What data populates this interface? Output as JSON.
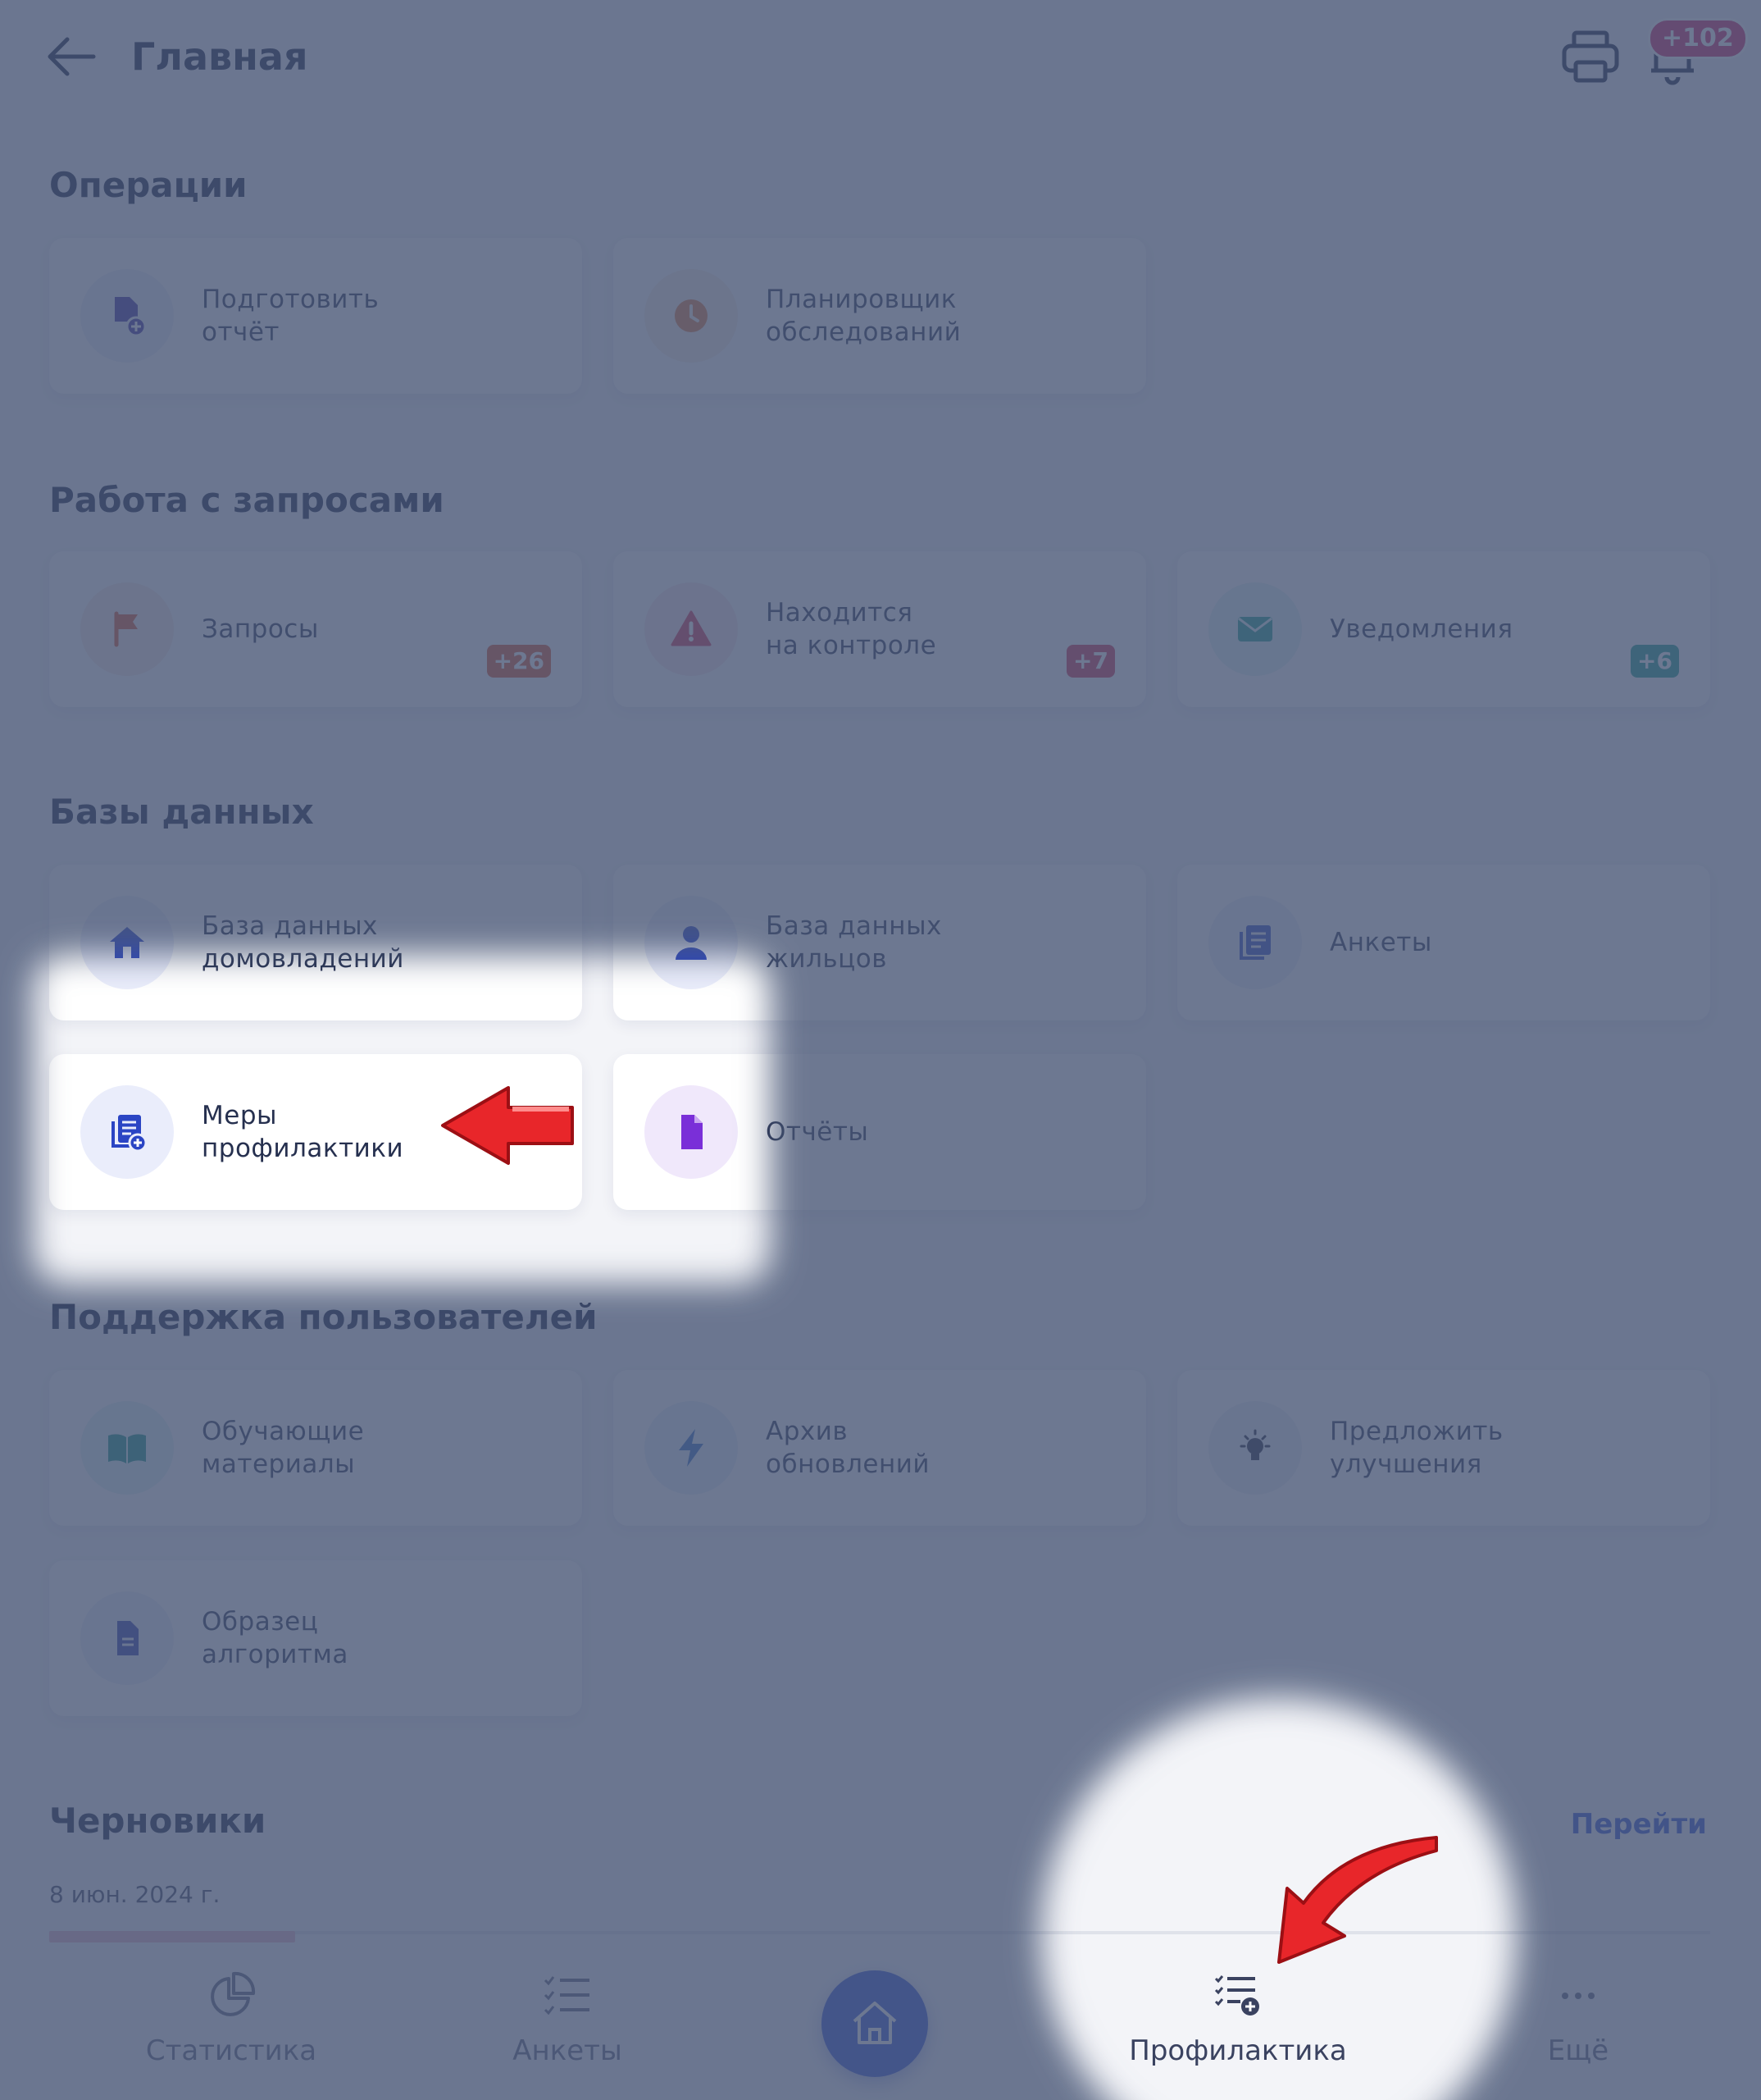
{
  "header": {
    "title": "Главная",
    "notifications_badge": "+102"
  },
  "sections": {
    "operations": {
      "title": "Операции",
      "items": [
        {
          "label": "Подготовить\nотчёт",
          "icon": "file-plus-icon"
        },
        {
          "label": "Планировщик\nобследований",
          "icon": "clock-icon"
        }
      ]
    },
    "requests": {
      "title": "Работа с запросами",
      "items": [
        {
          "label": "Запросы",
          "badge": "+26",
          "icon": "flag-icon",
          "badge_color": "#d9532c"
        },
        {
          "label": "Находится\nна контроле",
          "badge": "+7",
          "icon": "warning-icon",
          "badge_color": "#d0314f"
        },
        {
          "label": "Уведомления",
          "badge": "+6",
          "icon": "mail-icon",
          "badge_color": "#15998c"
        }
      ]
    },
    "databases": {
      "title": "Базы данных",
      "items": [
        {
          "label": "База данных\nдомовладений",
          "icon": "home-icon"
        },
        {
          "label": "База данных\nжильцов",
          "icon": "user-icon"
        },
        {
          "label": "Анкеты",
          "icon": "documents-icon"
        },
        {
          "label": "Меры\nпрофилактики",
          "icon": "list-plus-icon"
        },
        {
          "label": "Отчёты",
          "icon": "file-icon"
        }
      ]
    },
    "support": {
      "title": "Поддержка пользователей",
      "items": [
        {
          "label": "Обучающие\nматериалы",
          "icon": "book-icon"
        },
        {
          "label": "Архив\nобновлений",
          "icon": "bolt-icon"
        },
        {
          "label": "Предложить\nулучшения",
          "icon": "bulb-icon"
        },
        {
          "label": "Образец\nалгоритма",
          "icon": "doc-icon"
        }
      ]
    }
  },
  "drafts": {
    "title": "Черновики",
    "link": "Перейти",
    "date": "8 июн. 2024 г."
  },
  "bottom_nav": [
    {
      "label": "Статистика",
      "icon": "pie-chart-icon"
    },
    {
      "label": "Анкеты",
      "icon": "checklist-icon"
    },
    {
      "label": "",
      "icon": "home-icon"
    },
    {
      "label": "Профилактика",
      "icon": "list-plus-icon"
    },
    {
      "label": "Ещё",
      "icon": "more-icon"
    }
  ],
  "colors": {
    "accent": "#2f50d8",
    "title": "#101a3c",
    "overlay": "#485676"
  }
}
